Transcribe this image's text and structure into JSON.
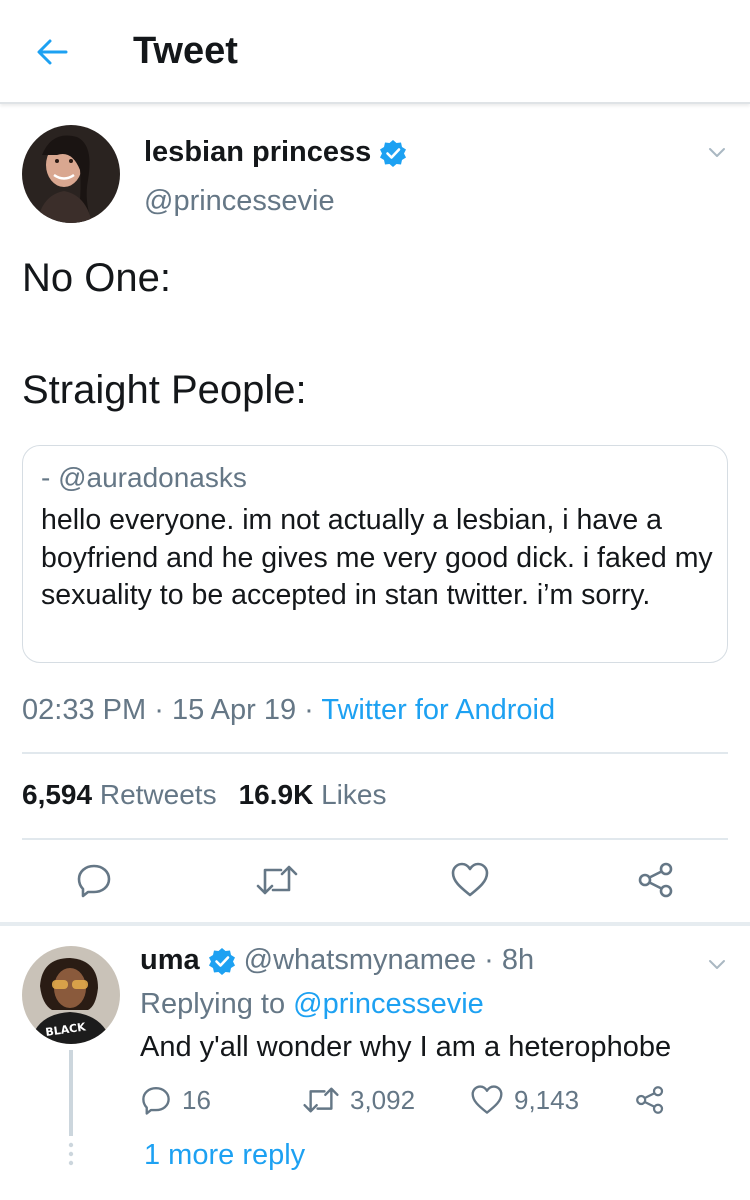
{
  "header": {
    "title": "Tweet",
    "back_icon": "arrow-left-icon"
  },
  "tweet": {
    "author_name": "lesbian princess",
    "author_handle": "@princessevie",
    "verified": true,
    "lines": [
      "No One:",
      "Straight People:"
    ],
    "quote": {
      "handle": "- @auradonasks",
      "text": "hello everyone. im not actually a lesbian, i have a boyfriend and he gives me very good dick. i faked my sexuality to be accepted in stan twitter. i’m sorry."
    },
    "time": "02:33 PM",
    "date": "15 Apr 19",
    "separator": "·",
    "source": "Twitter for Android",
    "retweets_count": "6,594",
    "retweets_label": "Retweets",
    "likes_count": "16.9K",
    "likes_label": "Likes",
    "actions": [
      "reply-icon",
      "retweet-icon",
      "like-icon",
      "share-icon"
    ]
  },
  "reply": {
    "author_name": "uma",
    "author_handle": "@whatsmynamee",
    "separator": "·",
    "time": "8h",
    "verified": true,
    "replying_prefix": "Replying to",
    "replying_to": "@princessevie",
    "text": "And y'all wonder why I am a heterophobe",
    "avatar_shirt_text": "BLACK",
    "reply_count": "16",
    "retweet_count": "3,092",
    "like_count": "9,143",
    "more_replies": "1 more reply"
  },
  "colors": {
    "accent": "#1da1f2",
    "text": "#14171a",
    "secondary": "#657786",
    "divider": "#e1e8ed",
    "icon": "#657786"
  }
}
